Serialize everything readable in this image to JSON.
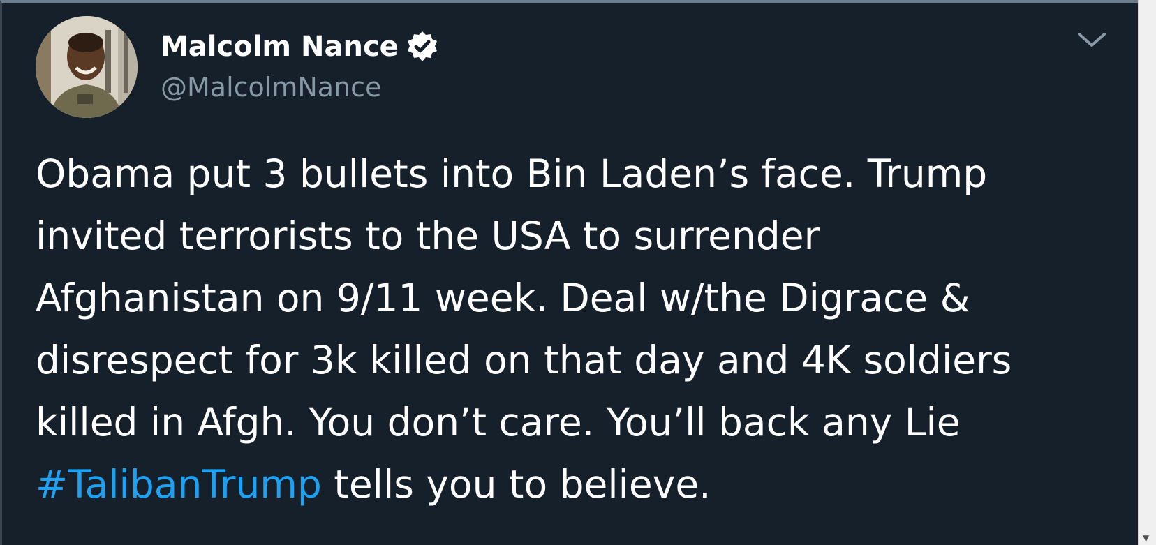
{
  "tweet": {
    "author": {
      "name": "Malcolm Nance",
      "handle": "@MalcolmNance",
      "verified": true
    },
    "icons": {
      "verified": "verified-badge-icon",
      "menu": "chevron-down-icon",
      "avatar": "profile-photo"
    },
    "text_lines": [
      "Obama put 3 bullets into Bin Laden’s face. Trump",
      "invited terrorists to the USA to surrender",
      "Afghanistan on 9/11 week. Deal w/the Digrace &",
      "disrespect for 3k killed on that day and 4K soldiers",
      "killed in Afgh. You don’t care. You’ll back any Lie"
    ],
    "last_line": {
      "hashtag": "#TalibanTrump",
      "rest": " tells you to believe."
    }
  },
  "colors": {
    "background": "#15202b",
    "text": "#ffffff",
    "handle": "#8899a6",
    "hashtag": "#1da1f2"
  }
}
